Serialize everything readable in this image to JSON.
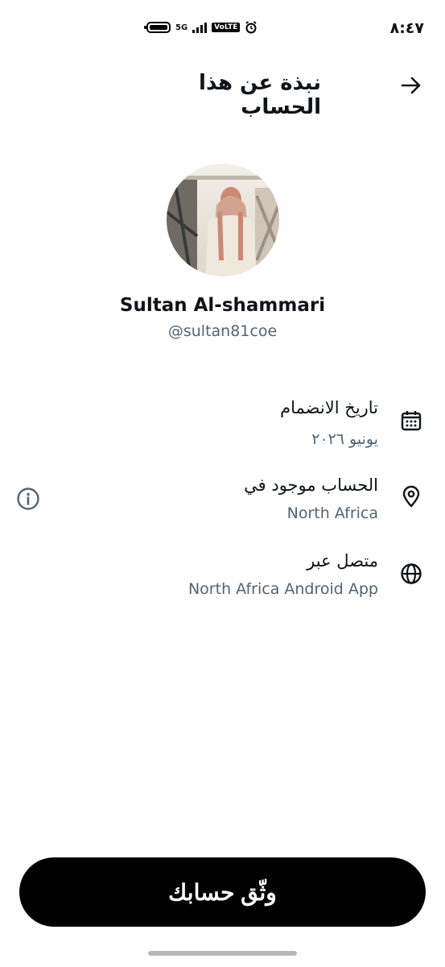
{
  "status_bar": {
    "time": "٨:٤٧",
    "network": "5G",
    "volte": "VoLTE"
  },
  "header": {
    "title": "نبذة عن هذا الحساب",
    "back_icon": "arrow-right-icon"
  },
  "profile": {
    "display_name": "Sultan Al-shammari",
    "handle": "@sultan81coe"
  },
  "info_rows": [
    {
      "title": "تاريخ الانضمام",
      "value": "يونيو ٢٠٢٦",
      "icon": "calendar-icon"
    },
    {
      "title": "الحساب موجود في",
      "value": "North Africa",
      "icon": "location-pin-icon",
      "trailing_icon": "info-icon"
    },
    {
      "title": "متصل عبر",
      "value": "North Africa Android App",
      "icon": "globe-icon"
    }
  ],
  "footer": {
    "verify_label": "وثّق حسابك"
  },
  "colors": {
    "primary_text": "#0f1419",
    "secondary_text": "#536471",
    "button_bg": "#000000",
    "button_text": "#ffffff"
  }
}
